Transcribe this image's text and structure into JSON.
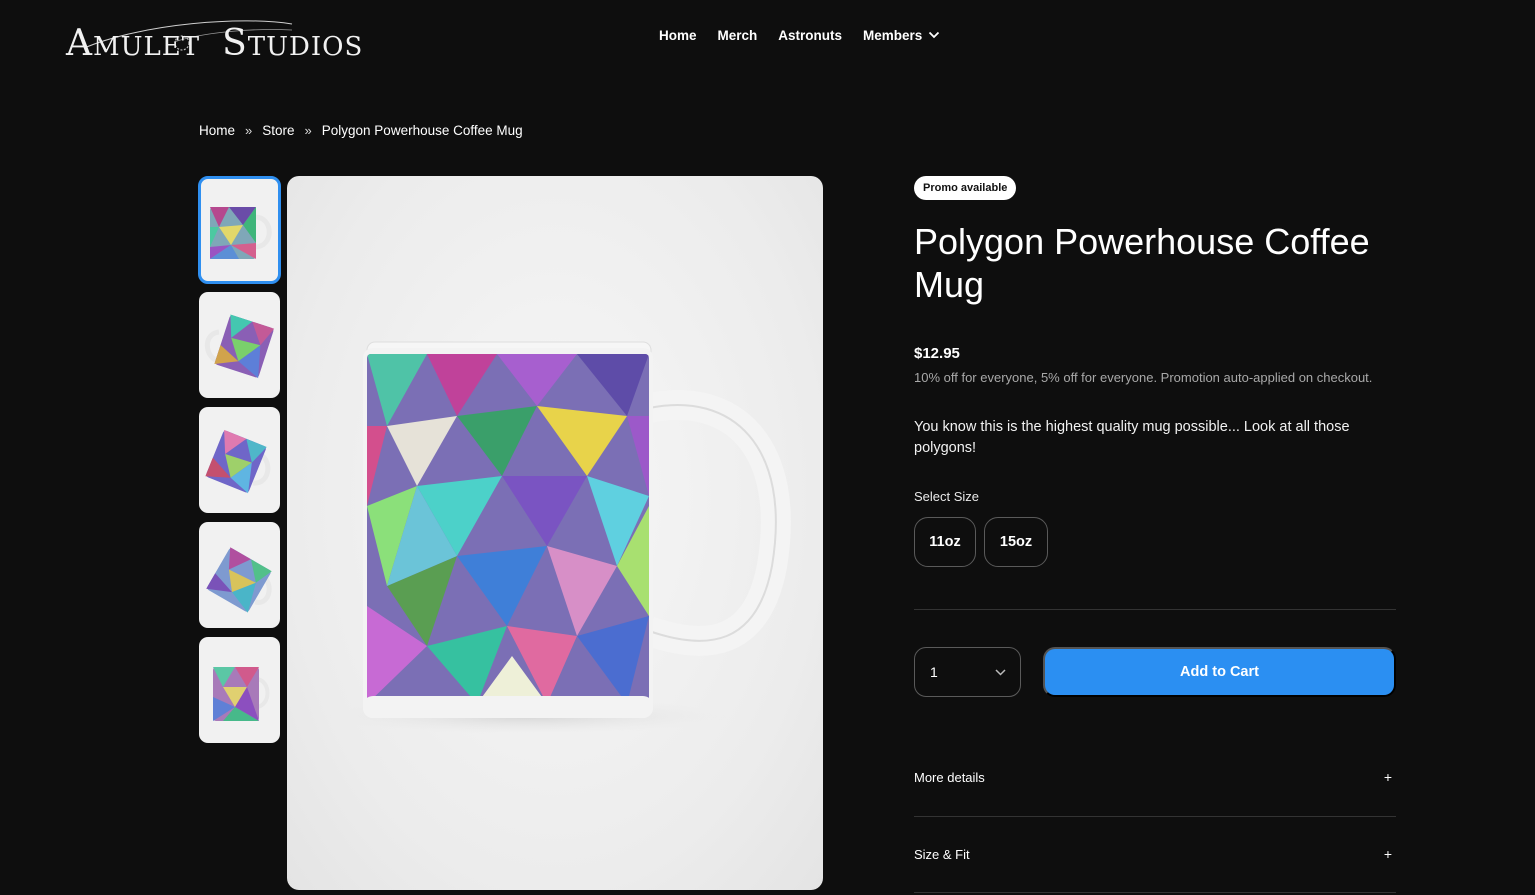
{
  "header": {
    "logo_text_first": "A",
    "logo_text_mid": "MULET",
    "logo_text_second": "S",
    "logo_text_end": "TUDIOS",
    "nav": [
      {
        "label": "Home"
      },
      {
        "label": "Merch"
      },
      {
        "label": "Astronuts"
      },
      {
        "label": "Members",
        "has_dropdown": true
      }
    ]
  },
  "breadcrumb": {
    "items": [
      "Home",
      "Store",
      "Polygon Powerhouse Coffee Mug"
    ],
    "separator": "»"
  },
  "gallery": {
    "thumbnail_count": 5,
    "active_index": 0,
    "selected_outline_color": "#2f8ff0"
  },
  "product": {
    "badge": "Promo available",
    "title": "Polygon Powerhouse Coffee Mug",
    "price": "$12.95",
    "promo_note": "10% off for everyone, 5% off for everyone. Promotion auto-applied on checkout.",
    "description": "You know this is the highest quality mug possible... Look at all those polygons!",
    "size_label": "Select Size",
    "sizes": [
      "11oz",
      "15oz"
    ],
    "quantity": "1",
    "add_to_cart": "Add to Cart",
    "accent_color": "#2b8ff2"
  },
  "accordions": [
    {
      "label": "More details",
      "icon": "+"
    },
    {
      "label": "Size & Fit",
      "icon": "+"
    }
  ]
}
